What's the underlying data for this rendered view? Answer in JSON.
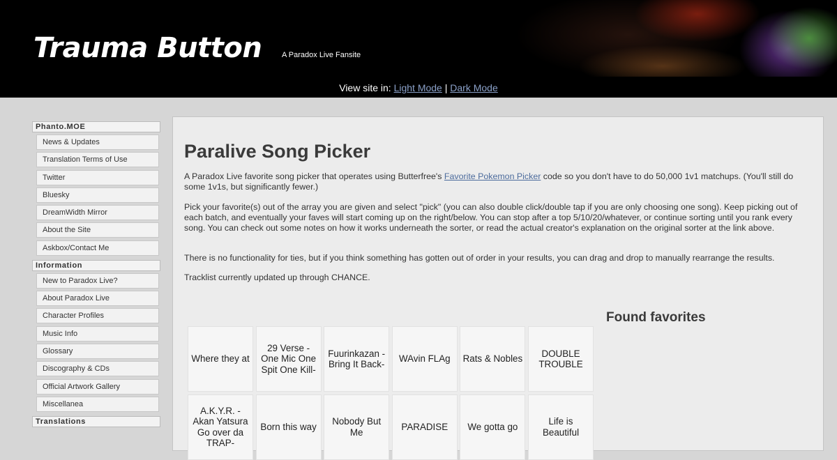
{
  "header": {
    "title": "Trauma Button",
    "subtitle": "A Paradox Live Fansite"
  },
  "modebar": {
    "prefix": "View site in:",
    "light_label": "Light Mode",
    "separator": "|",
    "dark_label": "Dark Mode"
  },
  "sidebar": {
    "sections": [
      {
        "heading": "Phanto.MOE",
        "items": [
          "News & Updates",
          "Translation Terms of Use",
          "Twitter",
          "Bluesky",
          "DreamWidth Mirror",
          "About the Site",
          "Askbox/Contact Me"
        ]
      },
      {
        "heading": "Information",
        "items": [
          "New to Paradox Live?",
          "About Paradox Live",
          "Character Profiles",
          "Music Info",
          "Glossary",
          "Discography & CDs",
          "Official Artwork Gallery",
          "Miscellanea"
        ]
      },
      {
        "heading": "Translations",
        "items": []
      }
    ]
  },
  "main": {
    "title": "Paralive Song Picker",
    "intro_before": "A Paradox Live favorite song picker that operates using Butterfree's ",
    "intro_link": "Favorite Pokemon Picker",
    "intro_after": " code so you don't have to do 50,000 1v1 matchups. (You'll still do some 1v1s, but significantly fewer.)",
    "para2": "Pick your favorite(s) out of the array you are given and select \"pick\" (you can also double click/double tap if you are only choosing one song). Keep picking out of each batch, and eventually your faves will start coming up on the right/below. You can stop after a top 5/10/20/whatever, or continue sorting until you rank every song. You can check out some notes on how it works underneath the sorter, or read the actual creator's explanation on the original sorter at the link above.",
    "para3": "There is no functionality for ties, but if you think something has gotten out of order in your results, you can drag and drop to manually rearrange the results.",
    "para4": "Tracklist currently updated up through CHANCE.",
    "found_heading": "Found favorites",
    "songs": [
      "Where they at",
      "29 Verse -One Mic One Spit One Kill-",
      "Fuurinkazan -Bring It Back-",
      "WAvin FLAg",
      "Rats & Nobles",
      "DOUBLE TROUBLE",
      "A.K.Y.R. -Akan Yatsura Go over da TRAP-",
      "Born this way",
      "Nobody But Me",
      "PARADISE",
      "We gotta go",
      "Life is Beautiful"
    ]
  }
}
